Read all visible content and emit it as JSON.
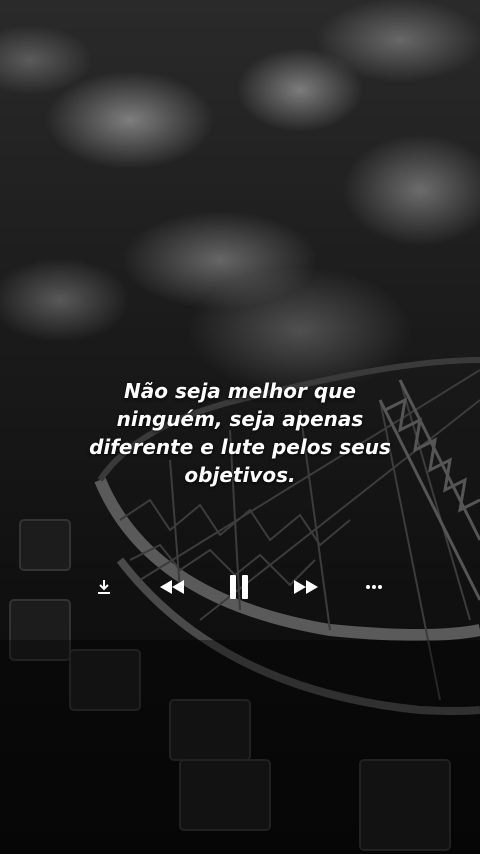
{
  "lyrics": {
    "line1": "Não seja melhor que",
    "line2": "ninguém, seja apenas",
    "line3": "diferente e lute pelos seus",
    "line4": "objetivos."
  },
  "player": {
    "controls": [
      "download-icon",
      "rewind-icon",
      "pause-icon",
      "fast-forward-icon",
      "more-icon"
    ],
    "icon_color": "#ffffff"
  }
}
